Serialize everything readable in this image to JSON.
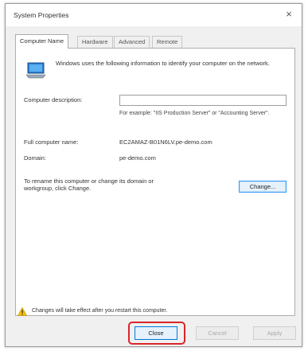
{
  "window": {
    "title": "System Properties",
    "close_glyph": "×"
  },
  "tabs": [
    {
      "label": "Computer Name",
      "active": true
    },
    {
      "label": "Hardware",
      "active": false
    },
    {
      "label": "Advanced",
      "active": false
    },
    {
      "label": "Remote",
      "active": false
    }
  ],
  "computer_name_tab": {
    "icon": "computer-icon",
    "intro": "Windows uses the following information to identify your computer on the network.",
    "description_label": "Computer description:",
    "description_value": "",
    "example": "For example: \"IIS Production Server\" or \"Accounting Server\".",
    "full_name_label": "Full computer name:",
    "full_name_value": "EC2AMAZ-B01N6LV.pe-demo.com",
    "domain_label": "Domain:",
    "domain_value": "pe-demo.com",
    "rename_text": "To rename this computer or change its domain or workgroup, click Change.",
    "change_button": "Change..."
  },
  "footer": {
    "warning_icon": "warning-icon",
    "warning_text": "Changes will take effect after you restart this computer.",
    "close_button": "Close",
    "cancel_button": "Cancel",
    "apply_button": "Apply"
  },
  "colors": {
    "highlight": "#d9252a",
    "focus": "#3399ff",
    "warning": "#f5c400"
  }
}
